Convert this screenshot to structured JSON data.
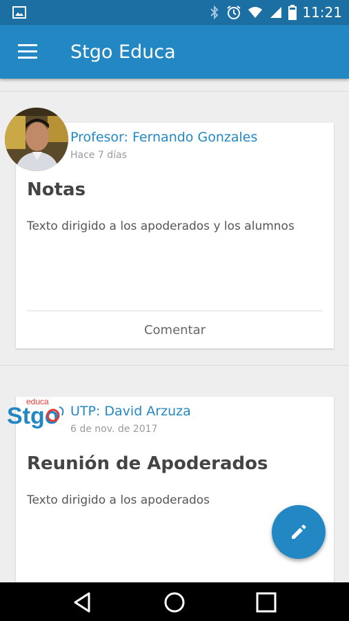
{
  "status_bar": {
    "time": "11:21"
  },
  "app_bar": {
    "title": "Stgo Educa"
  },
  "posts": [
    {
      "author": "Profesor: Fernando Gonzales",
      "date": "Hace 7 días",
      "title": "Notas",
      "text": "Texto dirigido a los apoderados y los alumnos",
      "comment_label": "Comentar"
    },
    {
      "author": "UTP: David Arzuza",
      "date": "6 de nov. de 2017",
      "title": "Reunión de Apoderados",
      "text": "Texto dirigido a los apoderados"
    }
  ],
  "logo": {
    "text_stgo": "Stgo",
    "text_educa": "educa"
  },
  "colors": {
    "primary": "#2387c4",
    "status": "#1c6fa3",
    "accent_logo": "#e53935"
  },
  "icons": [
    "image-icon",
    "bluetooth-icon",
    "alarm-icon",
    "wifi-icon",
    "signal-icon",
    "battery-icon",
    "menu-icon",
    "edit-icon",
    "back-icon",
    "home-icon",
    "recents-icon"
  ]
}
